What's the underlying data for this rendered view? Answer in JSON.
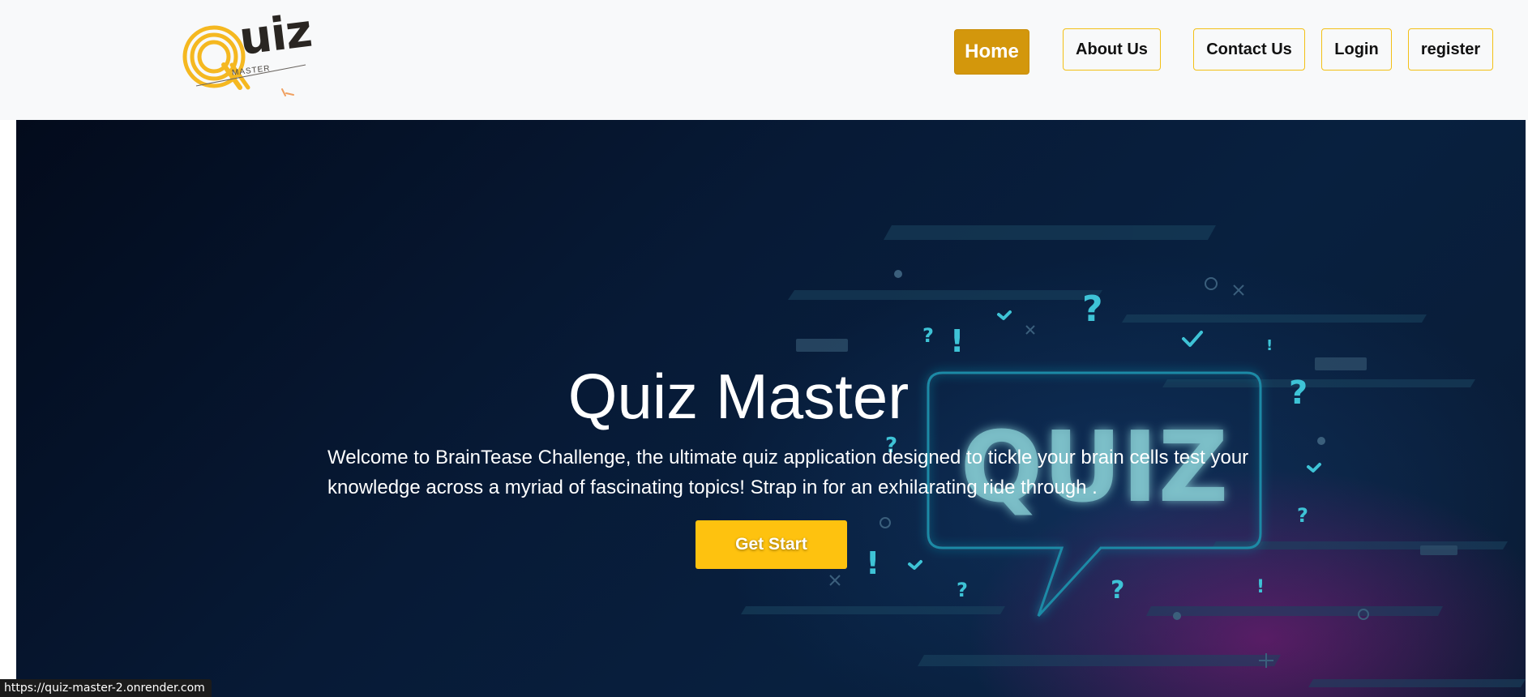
{
  "brand": {
    "logo_letter": "Q",
    "logo_word": "uiz",
    "logo_subtext": "MASTER",
    "accent_color": "#d3970c",
    "button_color": "#fec20f",
    "border_color": "#f3c016"
  },
  "nav": {
    "items": [
      {
        "label": "Home",
        "active": true
      },
      {
        "label": "About Us",
        "active": false
      },
      {
        "label": "Contact Us",
        "active": false
      },
      {
        "label": "Login",
        "active": false
      },
      {
        "label": "register",
        "active": false
      }
    ]
  },
  "hero": {
    "title": "Quiz Master",
    "description": "Welcome to BrainTease Challenge, the ultimate quiz application designed to tickle your brain cells test your knowledge across a myriad of fascinating topics! Strap in for an exhilarating ride through .",
    "cta_label": "Get Start",
    "background_word": "QUIZ"
  },
  "status_bar": {
    "url": "https://quiz-master-2.onrender.com"
  }
}
